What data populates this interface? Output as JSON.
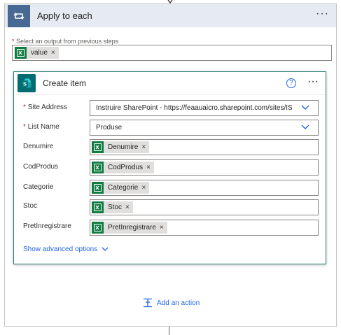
{
  "loop": {
    "title": "Apply to each",
    "more": "···",
    "select_label": "Select an output from previous steps",
    "required_mark": "*",
    "token": "value"
  },
  "action": {
    "title": "Create item",
    "help": "?",
    "more": "···",
    "fields": [
      {
        "label": "Site Address",
        "required": true,
        "value": "Instruire SharePoint - https://feaauaicro.sharepoint.com/sites/IS"
      },
      {
        "label": "List Name",
        "required": true,
        "value": "Produse"
      },
      {
        "label": "Denumire",
        "token": "Denumire"
      },
      {
        "label": "CodProdus",
        "token": "CodProdus"
      },
      {
        "label": "Categorie",
        "token": "Categorie"
      },
      {
        "label": "Stoc",
        "token": "Stoc"
      },
      {
        "label": "PretInregistrare",
        "token": "PretInregistrare"
      }
    ],
    "advanced_label": "Show advanced options"
  },
  "add_action_label": "Add an action",
  "token_close": "×",
  "colors": {
    "accent": "#2266e3",
    "loop_header": "#486991",
    "excel": "#107c41",
    "sharepoint": "#036c70"
  },
  "icons": {
    "loop": "loop-icon",
    "excel": "excel-icon",
    "sharepoint": "sharepoint-icon",
    "add": "add-action-icon"
  }
}
